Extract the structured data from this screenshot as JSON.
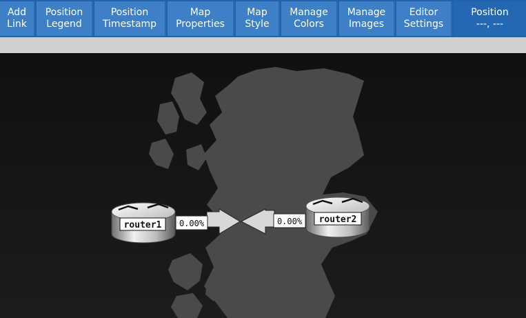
{
  "toolbar": {
    "buttons": [
      {
        "line1": "Add",
        "line2": "Link"
      },
      {
        "line1": "Position",
        "line2": "Legend"
      },
      {
        "line1": "Position",
        "line2": "Timestamp"
      },
      {
        "line1": "Map",
        "line2": "Properties"
      },
      {
        "line1": "Map",
        "line2": "Style"
      },
      {
        "line1": "Manage",
        "line2": "Colors"
      },
      {
        "line1": "Manage",
        "line2": "Images"
      },
      {
        "line1": "Editor",
        "line2": "Settings"
      }
    ],
    "position": {
      "label": "Position",
      "value": "---, ---"
    }
  },
  "map": {
    "nodes": [
      {
        "label": "router1"
      },
      {
        "label": "router2"
      }
    ],
    "links": [
      {
        "from_label": "0.00%",
        "to_label": "0.00%"
      }
    ]
  }
}
